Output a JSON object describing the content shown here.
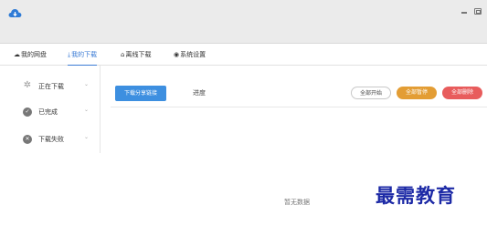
{
  "window": {
    "icons": {
      "logo": "cloud-download-icon",
      "minimize": "minimize-icon",
      "maximize": "maximize-icon"
    },
    "accent": "#3a7bd5"
  },
  "tabs": [
    {
      "icon": "cloud-icon",
      "label": "我的网盘",
      "active": false
    },
    {
      "icon": "download-icon",
      "label": "我的下载",
      "active": true
    },
    {
      "icon": "offline-download-icon",
      "label": "离线下载",
      "active": false
    },
    {
      "icon": "settings-icon",
      "label": "系统设置",
      "active": false
    }
  ],
  "sidebar": {
    "items": [
      {
        "icon": "spinner-icon",
        "label": "正在下载"
      },
      {
        "icon": "check-circle-icon",
        "label": "已完成"
      },
      {
        "icon": "error-circle-icon",
        "label": "下载失败"
      }
    ]
  },
  "toolbar": {
    "share_button": "下载分享链接",
    "progress_label": "进度",
    "start_all": "全部开始",
    "pause_all": "全部暂停",
    "delete_all": "全部删除",
    "colors": {
      "share": "#3d8fe0",
      "pause": "#e39d34",
      "delete": "#e85c5c"
    }
  },
  "main": {
    "empty_text": "暂无数据"
  },
  "watermark": "最需教育"
}
